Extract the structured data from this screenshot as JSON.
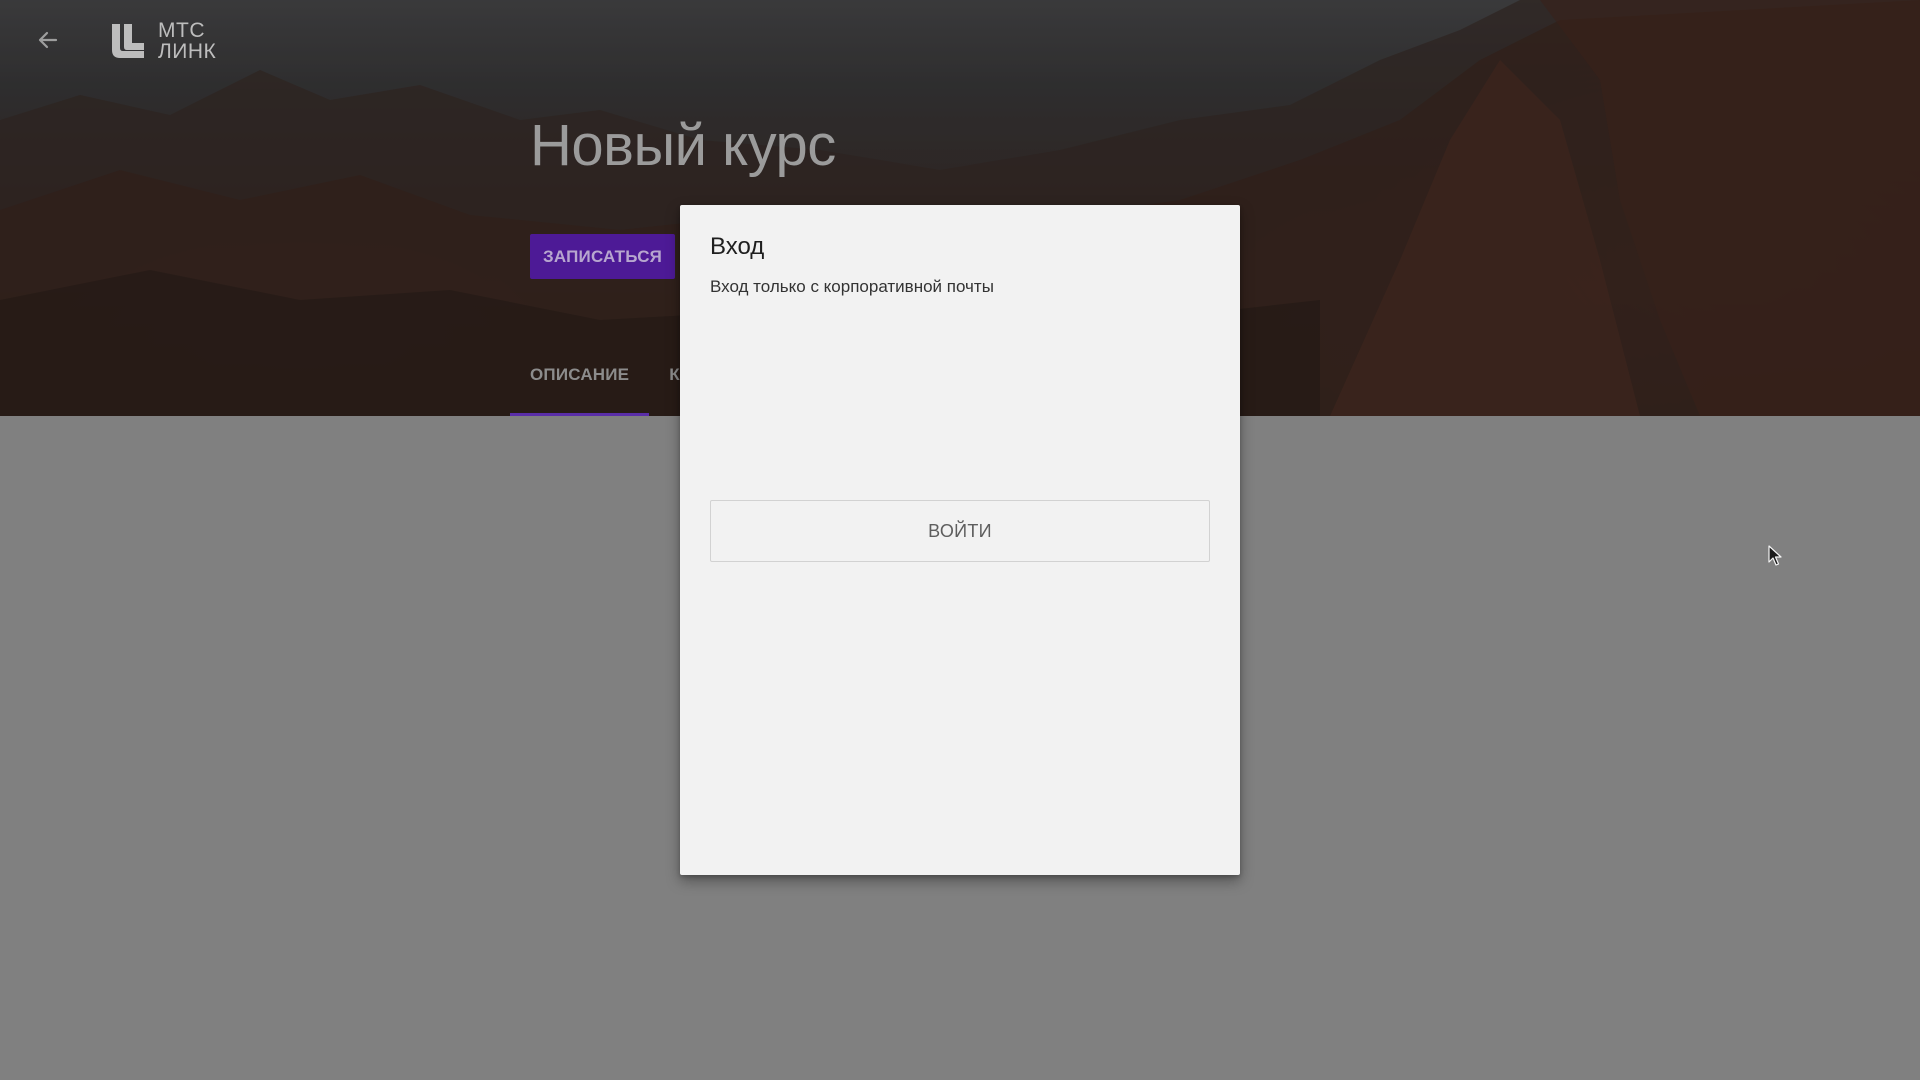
{
  "header": {
    "logo_line1": "МТС",
    "logo_line2": "ЛИНК",
    "back_icon": "arrow-left-icon"
  },
  "course": {
    "title": "Новый курс",
    "enroll_label": "ЗАПИСАТЬСЯ"
  },
  "tabs": [
    {
      "label": "ОПИСАНИЕ",
      "active": true
    },
    {
      "label": "К",
      "active": false
    }
  ],
  "modal": {
    "title": "Вход",
    "subtitle": "Вход только с корпоративной почты",
    "login_label": "ВОЙТИ"
  },
  "colors": {
    "accent": "#5a2ea8",
    "enroll_bg": "#4d1a96",
    "overlay": "#808080",
    "modal_bg": "#f2f2f2"
  }
}
